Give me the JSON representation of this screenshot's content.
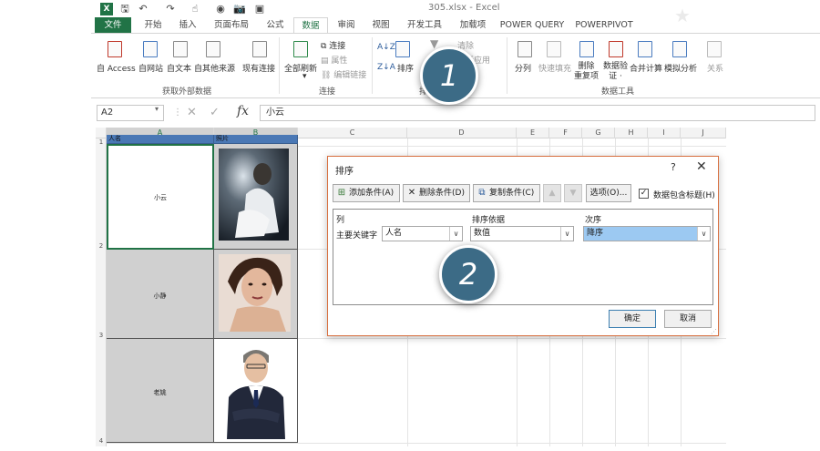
{
  "window": {
    "title": "305.xlsx - Excel",
    "app_icon": "excel-logo",
    "app_icon_text": "X"
  },
  "qat": [
    {
      "name": "save-icon",
      "glyph": "🖫"
    },
    {
      "name": "undo-icon",
      "glyph": "↶"
    },
    {
      "name": "redo-icon",
      "glyph": "↷"
    },
    {
      "name": "touch-mode-icon",
      "glyph": "☝"
    },
    {
      "name": "circle-icon",
      "glyph": "◉"
    },
    {
      "name": "camera-icon",
      "glyph": "📷"
    },
    {
      "name": "form-icon",
      "glyph": "▣"
    }
  ],
  "tabs": [
    "文件",
    "开始",
    "插入",
    "页面布局",
    "公式",
    "数据",
    "审阅",
    "视图",
    "开发工具",
    "加载项",
    "POWER QUERY",
    "POWERPIVOT"
  ],
  "active_tab": "数据",
  "ribbon": {
    "external": {
      "buttons": [
        "自 Access",
        "自网站",
        "自文本",
        "自其他来源",
        "现有连接"
      ],
      "group": "获取外部数据"
    },
    "connections": {
      "refresh": "全部刷新",
      "items": [
        "连接",
        "属性",
        "编辑链接"
      ],
      "group": "连接"
    },
    "sort": {
      "sort_label": "排序",
      "az": "A↓Z",
      "za": "Z↓A",
      "clear": "清除",
      "reapply": "重新应用",
      "group_partial": "排"
    },
    "tools": {
      "buttons": [
        "分列",
        "快速填充",
        "删除\n重复项",
        "数据验\n证 ·",
        "合并计算",
        "模拟分析",
        "关系"
      ],
      "group": "数据工具"
    }
  },
  "formula_bar": {
    "name_box": "A2",
    "formula": "小云",
    "fx": "fx",
    "cancel": "✕",
    "enter": "✓"
  },
  "sheet": {
    "columns": [
      "A",
      "B",
      "C",
      "D",
      "E",
      "F",
      "G",
      "H",
      "I",
      "J"
    ],
    "rows": [
      "1",
      "2",
      "3",
      "4"
    ],
    "header": {
      "a": "人名",
      "b": "照片"
    },
    "names": [
      "小云",
      "小静",
      "老姚"
    ]
  },
  "dialog": {
    "title": "排序",
    "help": "?",
    "close": "✕",
    "buttons": {
      "add": "添加条件(A)",
      "delete": "删除条件(D)",
      "copy": "复制条件(C)",
      "up": "▲",
      "down": "▼",
      "options": "选项(O)..."
    },
    "checkbox": {
      "label": "数据包含标题(H)",
      "checked": true,
      "mark": "☑"
    },
    "columns": {
      "col": "列",
      "sort_on": "排序依据",
      "order": "次序"
    },
    "row": {
      "key_label": "主要关键字",
      "column": "人名",
      "sort_on": "数值",
      "order": "降序"
    },
    "ok": "确定",
    "cancel": "取消"
  },
  "steps": [
    "1",
    "2"
  ],
  "colors": {
    "excel_green": "#217346",
    "header_blue": "#4a78b5",
    "step_circle": "#3c6b86",
    "selection_blue": "#9cc9f2",
    "dialog_border": "#d87040"
  }
}
